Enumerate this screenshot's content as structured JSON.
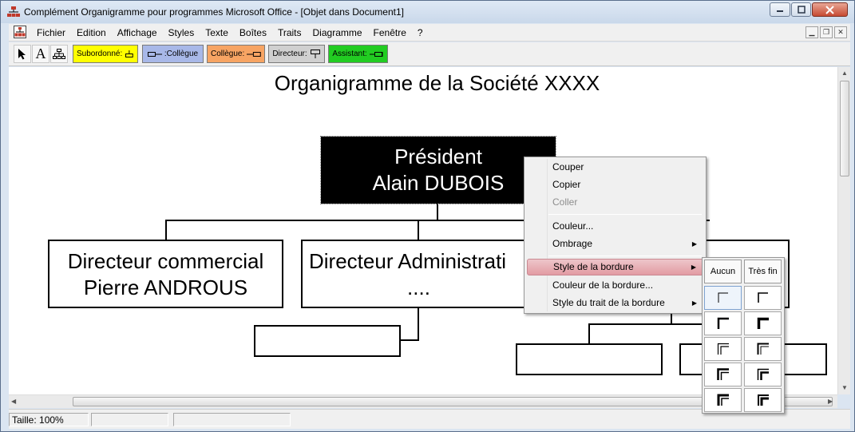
{
  "window": {
    "title": "Complément Organigramme pour programmes Microsoft Office - [Objet dans Document1]"
  },
  "menubar": {
    "items": [
      "Fichier",
      "Edition",
      "Affichage",
      "Styles",
      "Texte",
      "Boîtes",
      "Traits",
      "Diagramme",
      "Fenêtre",
      "?"
    ]
  },
  "toolbar": {
    "subordinate_label": "Subordonné:",
    "colleague_left_label": ":Collègue",
    "colleague_right_label": "Collègue:",
    "director_label": "Directeur:",
    "assistant_label": "Assistant:",
    "colors": {
      "subordinate": "#ffff00",
      "colleague_left": "#a8b8e8",
      "colleague_right": "#f7a463",
      "director": "#d0d0d0",
      "assistant": "#22cc22"
    }
  },
  "chart": {
    "title": "Organigramme de la Société XXXX",
    "president": {
      "line1": "Président",
      "line2": "Alain DUBOIS"
    },
    "director_commercial": {
      "line1": "Directeur commercial",
      "line2": "Pierre ANDROUS"
    },
    "director_admin": {
      "line1": "Directeur Administrati",
      "line2": "...."
    }
  },
  "context_menu": {
    "items": [
      {
        "label": "Couper",
        "disabled": false
      },
      {
        "label": "Copier",
        "disabled": false
      },
      {
        "label": "Coller",
        "disabled": true
      },
      {
        "label": "Couleur...",
        "disabled": false
      },
      {
        "label": "Ombrage",
        "disabled": false,
        "submenu": true
      },
      {
        "label": "Style de la bordure",
        "disabled": false,
        "submenu": true,
        "highlighted": true
      },
      {
        "label": "Couleur de la bordure...",
        "disabled": false
      },
      {
        "label": "Style du trait de la bordure",
        "disabled": false,
        "submenu": true
      }
    ]
  },
  "border_submenu": {
    "none_label": "Aucun",
    "very_thin_label": "Très fin"
  },
  "statusbar": {
    "zoom": "Taille: 100%"
  }
}
